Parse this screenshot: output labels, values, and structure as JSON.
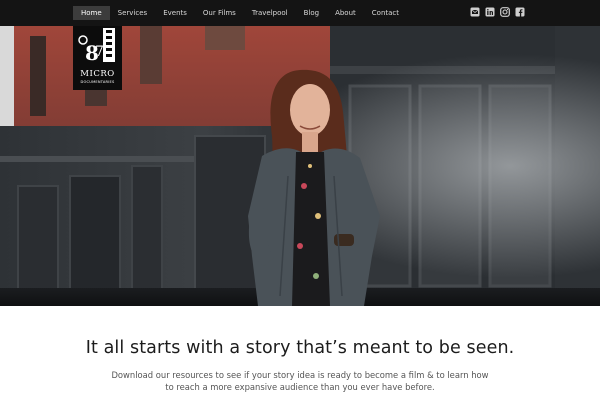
{
  "nav": {
    "items": [
      {
        "label": "Home",
        "active": true
      },
      {
        "label": "Services",
        "active": false
      },
      {
        "label": "Events",
        "active": false
      },
      {
        "label": "Our Films",
        "active": false
      },
      {
        "label": "Travelpool",
        "active": false
      },
      {
        "label": "Blog",
        "active": false
      },
      {
        "label": "About",
        "active": false
      },
      {
        "label": "Contact",
        "active": false
      }
    ],
    "social_icons": [
      "email-icon",
      "linkedin-icon",
      "instagram-icon",
      "facebook-icon"
    ]
  },
  "logo": {
    "title": "MICRO",
    "subtitle": "DOCUMENTARIES"
  },
  "hero": {
    "description_icon": "portrait-photo"
  },
  "content": {
    "headline": "It all starts with a story that’s meant to be seen.",
    "subtext": "Download our resources to see if your story idea is ready to become a film & to learn how to reach a more expansive audience than you ever have before."
  },
  "colors": {
    "nav_bg": "#141414",
    "nav_active": "#3c3c3c",
    "text_dark": "#1c1c1c",
    "text_muted": "#555555"
  }
}
